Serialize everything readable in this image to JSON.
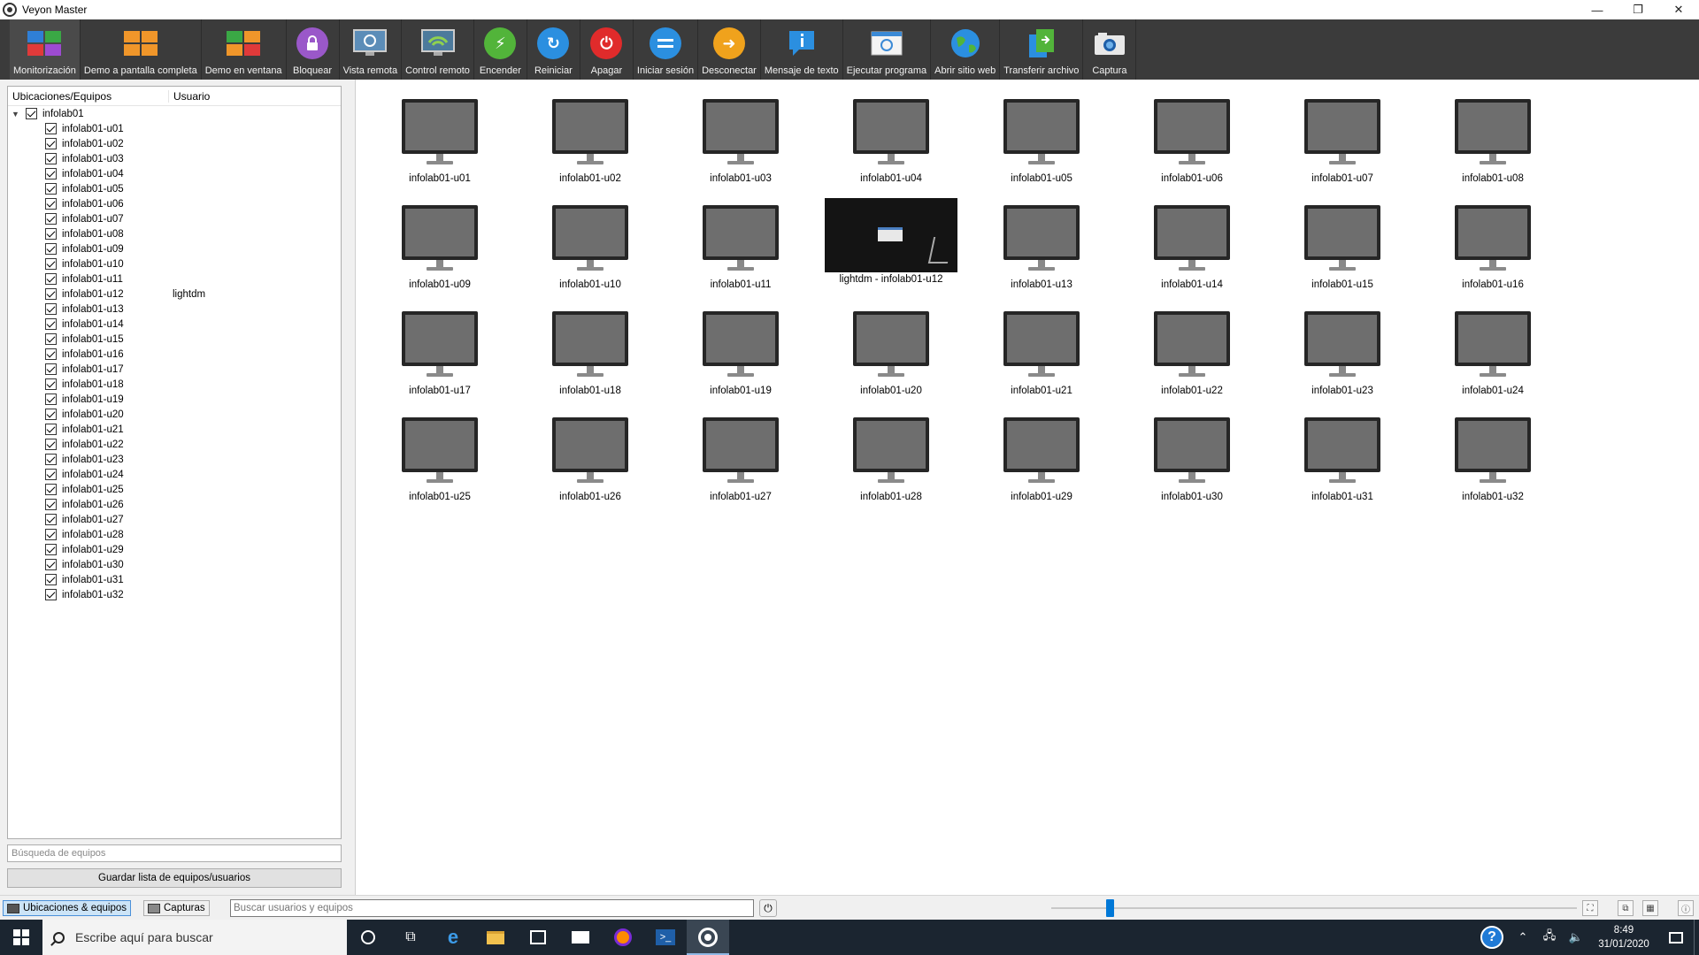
{
  "window": {
    "title": "Veyon Master",
    "controls": [
      "—",
      "❐",
      "✕"
    ]
  },
  "toolbar": {
    "buttons": [
      {
        "label": "Monitorización",
        "icon": "monitoring-icon",
        "active": true
      },
      {
        "label": "Demo a pantalla completa",
        "icon": "fullscreen-demo-icon"
      },
      {
        "label": "Demo en ventana",
        "icon": "window-demo-icon"
      },
      {
        "label": "Bloquear",
        "icon": "lock-icon"
      },
      {
        "label": "Vista remota",
        "icon": "remote-view-icon"
      },
      {
        "label": "Control remoto",
        "icon": "remote-control-icon"
      },
      {
        "label": "Encender",
        "icon": "power-on-icon"
      },
      {
        "label": "Reiniciar",
        "icon": "reboot-icon"
      },
      {
        "label": "Apagar",
        "icon": "power-off-icon"
      },
      {
        "label": "Iniciar sesión",
        "icon": "login-icon"
      },
      {
        "label": "Desconectar",
        "icon": "logout-icon"
      },
      {
        "label": "Mensaje de texto",
        "icon": "text-message-icon"
      },
      {
        "label": "Ejecutar programa",
        "icon": "run-program-icon"
      },
      {
        "label": "Abrir sitio web",
        "icon": "open-website-icon"
      },
      {
        "label": "Transferir archivo",
        "icon": "file-transfer-icon"
      },
      {
        "label": "Captura",
        "icon": "screenshot-icon"
      }
    ]
  },
  "tree": {
    "header_locations": "Ubicaciones/Equipos",
    "header_user": "Usuario",
    "root": "infolab01",
    "items": [
      {
        "name": "infolab01-u01",
        "user": ""
      },
      {
        "name": "infolab01-u02",
        "user": ""
      },
      {
        "name": "infolab01-u03",
        "user": ""
      },
      {
        "name": "infolab01-u04",
        "user": ""
      },
      {
        "name": "infolab01-u05",
        "user": ""
      },
      {
        "name": "infolab01-u06",
        "user": ""
      },
      {
        "name": "infolab01-u07",
        "user": ""
      },
      {
        "name": "infolab01-u08",
        "user": ""
      },
      {
        "name": "infolab01-u09",
        "user": ""
      },
      {
        "name": "infolab01-u10",
        "user": ""
      },
      {
        "name": "infolab01-u11",
        "user": ""
      },
      {
        "name": "infolab01-u12",
        "user": "lightdm"
      },
      {
        "name": "infolab01-u13",
        "user": ""
      },
      {
        "name": "infolab01-u14",
        "user": ""
      },
      {
        "name": "infolab01-u15",
        "user": ""
      },
      {
        "name": "infolab01-u16",
        "user": ""
      },
      {
        "name": "infolab01-u17",
        "user": ""
      },
      {
        "name": "infolab01-u18",
        "user": ""
      },
      {
        "name": "infolab01-u19",
        "user": ""
      },
      {
        "name": "infolab01-u20",
        "user": ""
      },
      {
        "name": "infolab01-u21",
        "user": ""
      },
      {
        "name": "infolab01-u22",
        "user": ""
      },
      {
        "name": "infolab01-u23",
        "user": ""
      },
      {
        "name": "infolab01-u24",
        "user": ""
      },
      {
        "name": "infolab01-u25",
        "user": ""
      },
      {
        "name": "infolab01-u26",
        "user": ""
      },
      {
        "name": "infolab01-u27",
        "user": ""
      },
      {
        "name": "infolab01-u28",
        "user": ""
      },
      {
        "name": "infolab01-u29",
        "user": ""
      },
      {
        "name": "infolab01-u30",
        "user": ""
      },
      {
        "name": "infolab01-u31",
        "user": ""
      },
      {
        "name": "infolab01-u32",
        "user": ""
      }
    ],
    "search_placeholder": "Búsqueda de equipos",
    "save_button": "Guardar lista de equipos/usuarios"
  },
  "computers": [
    {
      "label": "infolab01-u01"
    },
    {
      "label": "infolab01-u02"
    },
    {
      "label": "infolab01-u03"
    },
    {
      "label": "infolab01-u04"
    },
    {
      "label": "infolab01-u05"
    },
    {
      "label": "infolab01-u06"
    },
    {
      "label": "infolab01-u07"
    },
    {
      "label": "infolab01-u08"
    },
    {
      "label": "infolab01-u09"
    },
    {
      "label": "infolab01-u10"
    },
    {
      "label": "infolab01-u11"
    },
    {
      "label": "lightdm - infolab01-u12",
      "screenshot": true
    },
    {
      "label": "infolab01-u13"
    },
    {
      "label": "infolab01-u14"
    },
    {
      "label": "infolab01-u15"
    },
    {
      "label": "infolab01-u16"
    },
    {
      "label": "infolab01-u17"
    },
    {
      "label": "infolab01-u18"
    },
    {
      "label": "infolab01-u19"
    },
    {
      "label": "infolab01-u20"
    },
    {
      "label": "infolab01-u21"
    },
    {
      "label": "infolab01-u22"
    },
    {
      "label": "infolab01-u23"
    },
    {
      "label": "infolab01-u24"
    },
    {
      "label": "infolab01-u25"
    },
    {
      "label": "infolab01-u26"
    },
    {
      "label": "infolab01-u27"
    },
    {
      "label": "infolab01-u28"
    },
    {
      "label": "infolab01-u29"
    },
    {
      "label": "infolab01-u30"
    },
    {
      "label": "infolab01-u31"
    },
    {
      "label": "infolab01-u32"
    }
  ],
  "statusbar": {
    "tab_locations": "Ubicaciones & equipos",
    "tab_screenshots": "Capturas",
    "search_placeholder": "Buscar usuarios y equipos"
  },
  "taskbar": {
    "search_placeholder": "Escribe aquí para buscar",
    "time": "8:49",
    "date": "31/01/2020"
  }
}
